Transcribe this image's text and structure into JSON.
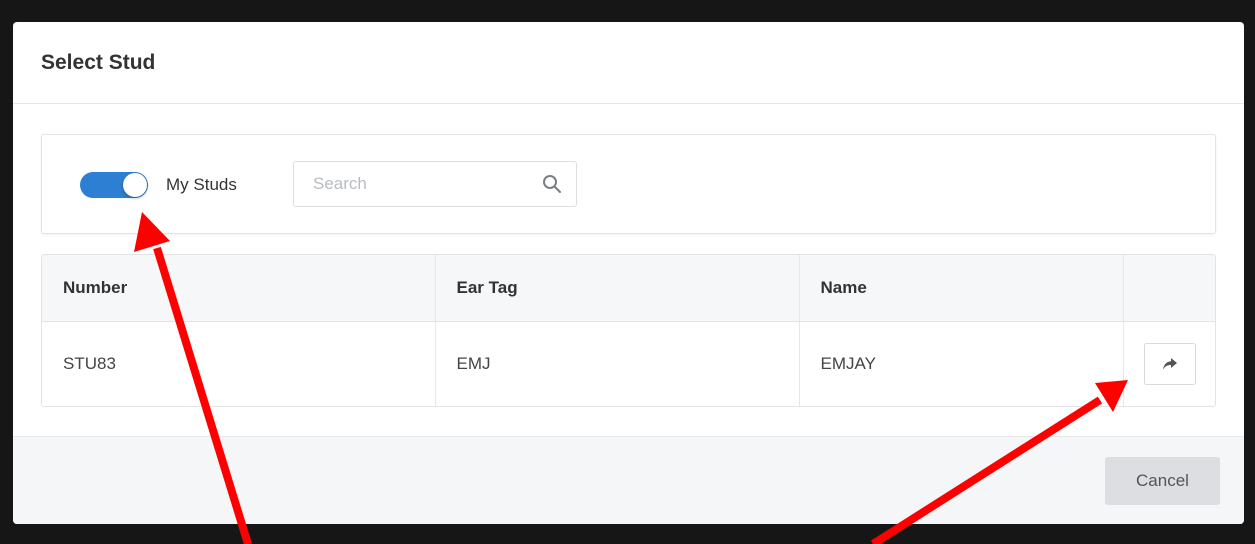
{
  "modal": {
    "title": "Select Stud"
  },
  "filters": {
    "toggle_label": "My Studs",
    "toggle_on": true,
    "search": {
      "placeholder": "Search",
      "value": ""
    }
  },
  "table": {
    "columns": [
      "Number",
      "Ear Tag",
      "Name"
    ],
    "rows": [
      {
        "number": "STU83",
        "ear_tag": "EMJ",
        "name": "EMJAY"
      }
    ]
  },
  "footer": {
    "cancel_label": "Cancel"
  },
  "colors": {
    "toggle_accent": "#2d7fd3",
    "annotation_arrow": "#ff0000"
  },
  "icons": {
    "search": "search-icon",
    "row_action": "share-forward-icon"
  }
}
